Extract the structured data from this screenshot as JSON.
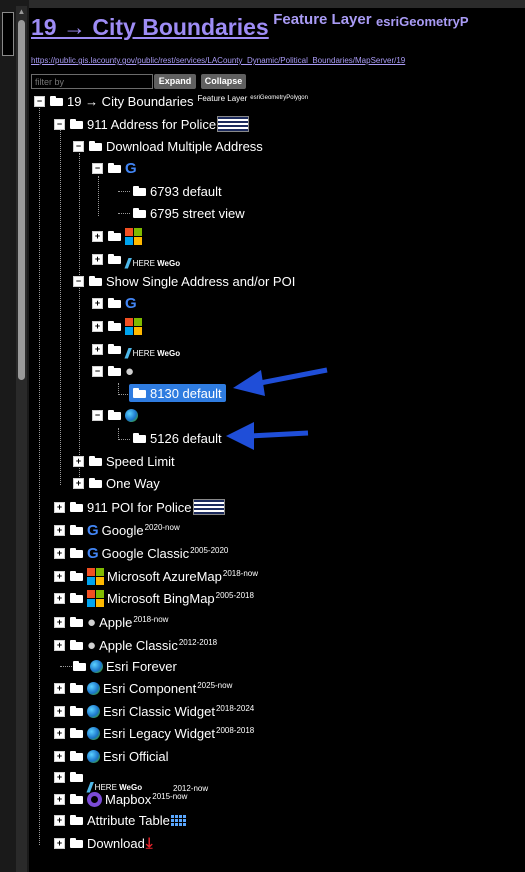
{
  "header": {
    "title": "19 → City Boundaries",
    "sup1": "Feature Layer",
    "sup2": "esriGeometryP",
    "url": "https://public.gis.lacounty.gov/public/rest/services/LACounty_Dynamic/Political_Boundaries/MapServer/19",
    "filter_placeholder": "filter by",
    "expand_label": "Expand",
    "collapse_label": "Collapse"
  },
  "tree": {
    "root": {
      "label": "19 → City Boundaries",
      "sup1": "Feature Layer",
      "sup2": "esriGeometryPolygon"
    },
    "address_police": "911 Address for Police",
    "download_multiple": "Download Multiple Address",
    "dm_6793": "6793 default",
    "dm_6795": "6795 street view",
    "here_label": "HERE",
    "wego_label": "WeGo",
    "show_single": "Show Single Address and/or POI",
    "ss_8130": "8130 default",
    "ss_5126": "5126 default",
    "speed_limit": "Speed Limit",
    "one_way": "One Way",
    "poi_police": "911 POI for Police",
    "google": {
      "label": "Google",
      "sup": "2020-now"
    },
    "google_classic": {
      "label": "Google Classic",
      "sup": "2005-2020"
    },
    "ms_azure": {
      "label": "Microsoft AzureMap",
      "sup": "2018-now"
    },
    "ms_bing": {
      "label": "Microsoft BingMap",
      "sup": "2005-2018"
    },
    "apple": {
      "label": "Apple",
      "sup": "2018-now"
    },
    "apple_classic": {
      "label": "Apple Classic",
      "sup": "2012-2018"
    },
    "esri_forever": "Esri Forever",
    "esri_component": {
      "label": "Esri Component",
      "sup": "2025-now"
    },
    "esri_classic_widget": {
      "label": "Esri Classic Widget",
      "sup": "2018-2024"
    },
    "esri_legacy_widget": {
      "label": "Esri Legacy Widget",
      "sup": "2008-2018"
    },
    "esri_official": "Esri Official",
    "here_sup": "2012-now",
    "mapbox": {
      "label": "Mapbox",
      "sup": "2015-now"
    },
    "attribute_table": "Attribute Table",
    "download": "Download"
  },
  "colors": {
    "accent": "#9e8cf5",
    "selected_bg": "#2f7ce0",
    "arrow": "#1f4ed8",
    "google_blue": "#4285f4",
    "ms_red": "#f25022",
    "ms_green": "#7fba00",
    "ms_blue": "#00a4ef",
    "ms_yellow": "#ffb900"
  },
  "icons": [
    "google-icon",
    "microsoft-icon",
    "here-wego-icon",
    "apple-icon",
    "globe-icon",
    "mapbox-icon",
    "table-icon",
    "download-icon",
    "flag-icon",
    "folder-icon"
  ]
}
